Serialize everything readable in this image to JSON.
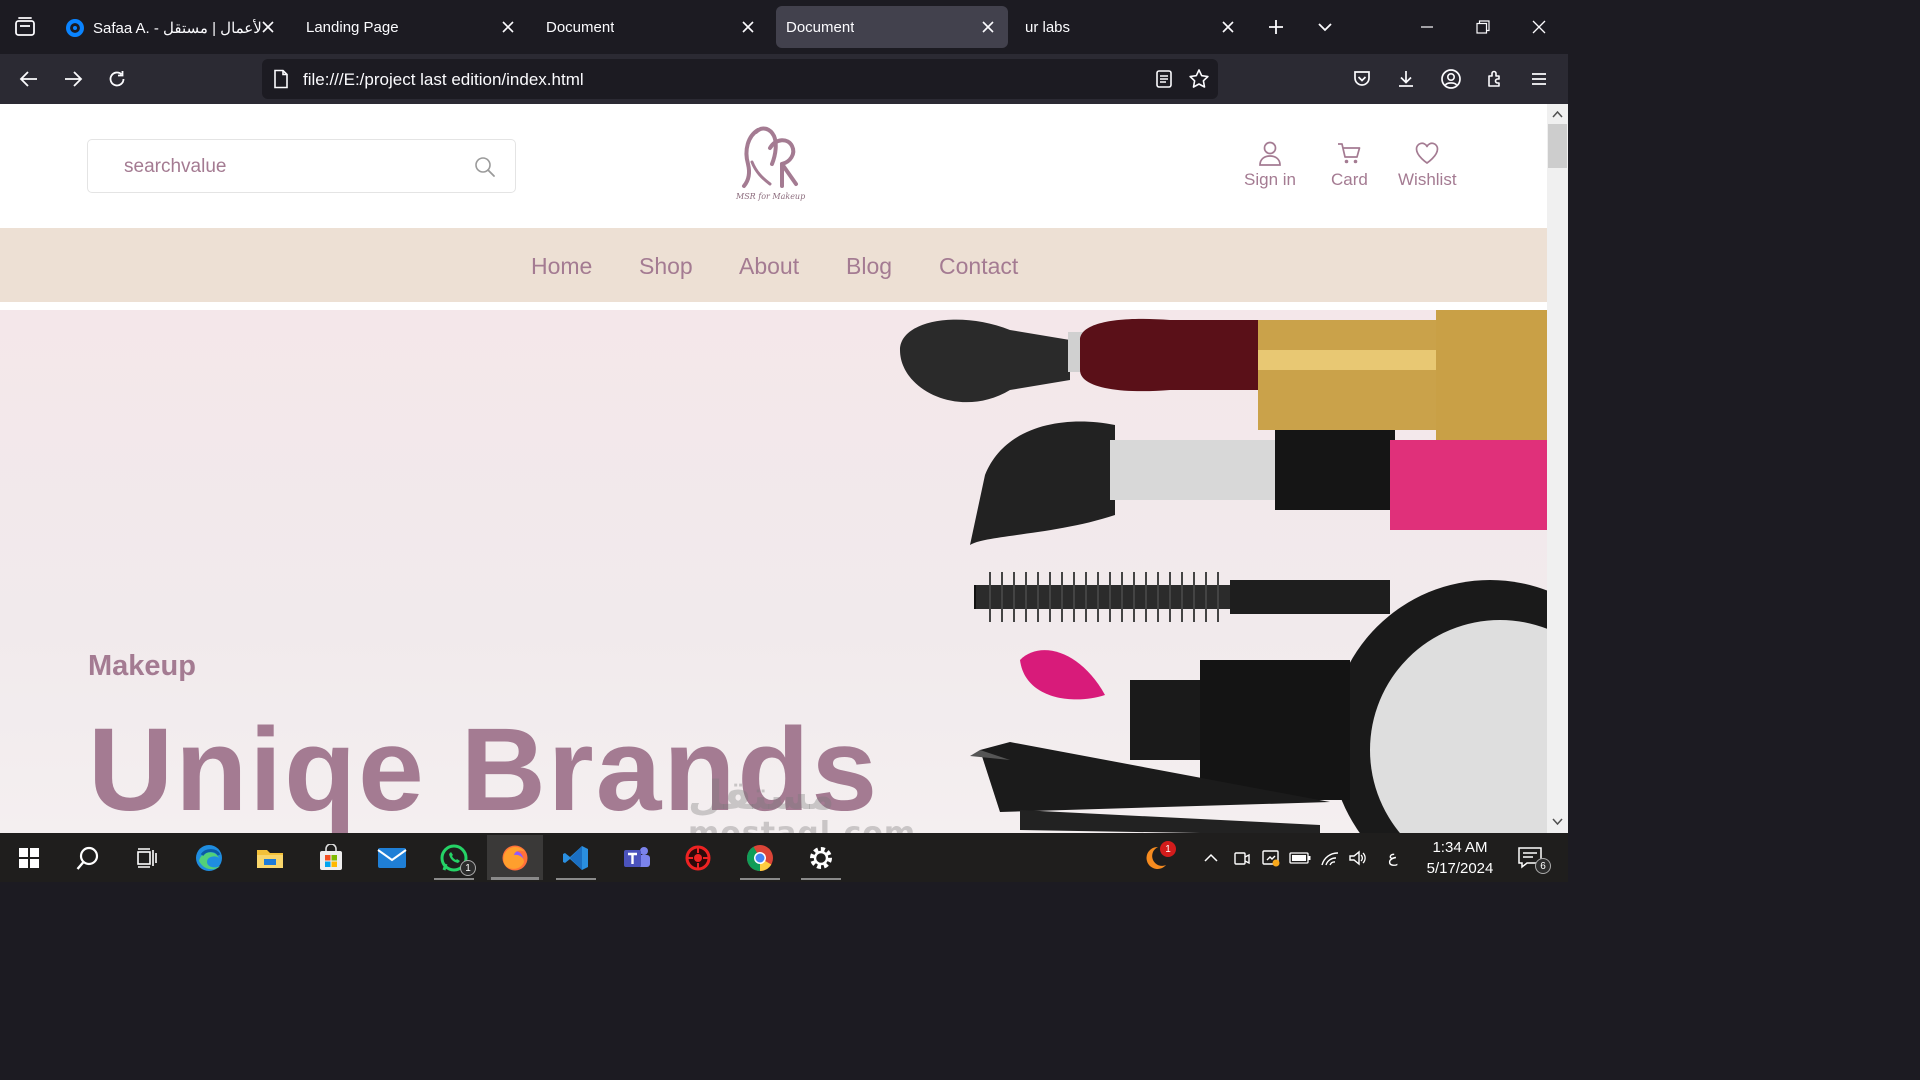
{
  "browser": {
    "tabs": [
      {
        "title": "Safaa A. - الأعمال | مستقل",
        "active": false
      },
      {
        "title": "Landing Page",
        "active": false
      },
      {
        "title": "Document",
        "active": false
      },
      {
        "title": "Document",
        "active": true
      },
      {
        "title": "ur labs",
        "active": false
      }
    ],
    "url": "file:///E:/project last edition/index.html"
  },
  "site": {
    "search": {
      "value": "searchvalue"
    },
    "logo": {
      "caption": "MSR for Makeup"
    },
    "header_actions": {
      "sign_in": "Sign in",
      "card": "Card",
      "wishlist": "Wishlist"
    },
    "nav": [
      "Home",
      "Shop",
      "About",
      "Blog",
      "Contact"
    ],
    "hero": {
      "kicker": "Makeup",
      "title": "Uniqe Brands"
    },
    "colors": {
      "brand": "#a47b92",
      "nav_bg": "#ede0d4"
    }
  },
  "taskbar": {
    "apps": [
      "start-icon",
      "search-icon",
      "task-view-icon",
      "edge-icon",
      "file-explorer-icon",
      "microsoft-store-icon",
      "mail-icon",
      "whatsapp-icon",
      "firefox-icon",
      "vscode-icon",
      "teams-icon",
      "app-red-icon",
      "chrome-icon",
      "settings-icon"
    ],
    "whatsapp_badge": "1",
    "tray_badge": "1",
    "ime": "ع",
    "time": "1:34 AM",
    "date": "5/17/2024",
    "notifications": "6"
  },
  "watermark": {
    "arabic": "مستقل",
    "latin": "mostaql.com"
  }
}
